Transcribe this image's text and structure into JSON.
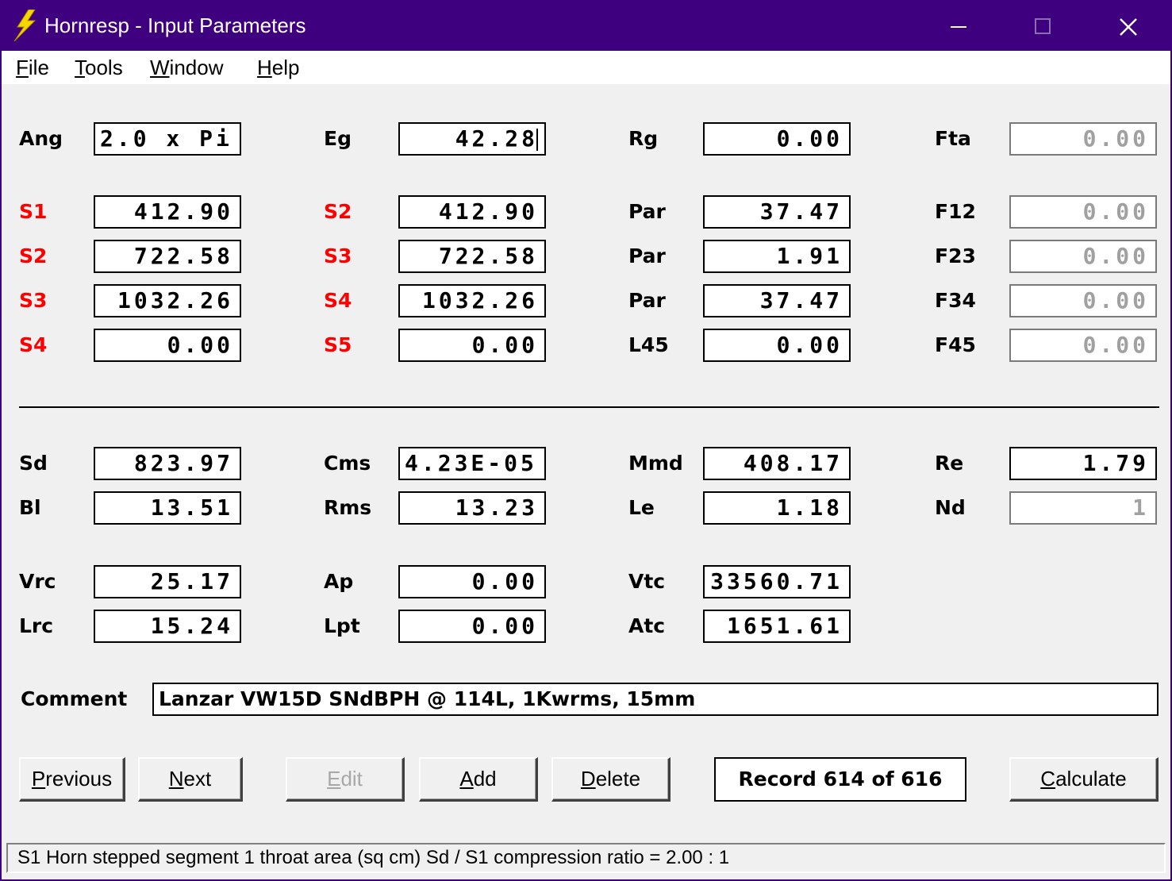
{
  "window": {
    "title": "Hornresp - Input Parameters",
    "controls": [
      "minimize-icon",
      "maximize-icon",
      "close-icon"
    ]
  },
  "menu": [
    {
      "pre": "",
      "u": "F",
      "post": "ile"
    },
    {
      "pre": "",
      "u": "T",
      "post": "ools"
    },
    {
      "pre": "",
      "u": "W",
      "post": "indow"
    },
    {
      "pre": "",
      "u": "H",
      "post": "elp"
    }
  ],
  "params": {
    "ang": {
      "label": "Ang",
      "value": "2.0 x Pi"
    },
    "eg": {
      "label": "Eg",
      "value": "42.28"
    },
    "rg": {
      "label": "Rg",
      "value": "0.00"
    },
    "fta": {
      "label": "Fta",
      "value": "0.00"
    },
    "col1": [
      {
        "label": "S1",
        "value": "412.90"
      },
      {
        "label": "S2",
        "value": "722.58"
      },
      {
        "label": "S3",
        "value": "1032.26"
      },
      {
        "label": "S4",
        "value": "0.00"
      }
    ],
    "col2": [
      {
        "label": "S2",
        "value": "412.90"
      },
      {
        "label": "S3",
        "value": "722.58"
      },
      {
        "label": "S4",
        "value": "1032.26"
      },
      {
        "label": "S5",
        "value": "0.00"
      }
    ],
    "col3": [
      {
        "label": "Par",
        "value": "37.47"
      },
      {
        "label": "Par",
        "value": "1.91"
      },
      {
        "label": "Par",
        "value": "37.47"
      },
      {
        "label": "L45",
        "value": "0.00"
      }
    ],
    "col4": [
      {
        "label": "F12",
        "value": "0.00"
      },
      {
        "label": "F23",
        "value": "0.00"
      },
      {
        "label": "F34",
        "value": "0.00"
      },
      {
        "label": "F45",
        "value": "0.00"
      }
    ],
    "driver": [
      {
        "label": "Sd",
        "value": "823.97"
      },
      {
        "label": "Cms",
        "value": "4.23E-05"
      },
      {
        "label": "Mmd",
        "value": "408.17"
      },
      {
        "label": "Re",
        "value": "1.79"
      },
      {
        "label": "Bl",
        "value": "13.51"
      },
      {
        "label": "Rms",
        "value": "13.23"
      },
      {
        "label": "Le",
        "value": "1.18"
      },
      {
        "label": "Nd",
        "value": "1"
      }
    ],
    "chamber": [
      {
        "label": "Vrc",
        "value": "25.17"
      },
      {
        "label": "Ap",
        "value": "0.00"
      },
      {
        "label": "Vtc",
        "value": "33560.71"
      },
      {
        "label": "Lrc",
        "value": "15.24"
      },
      {
        "label": "Lpt",
        "value": "0.00"
      },
      {
        "label": "Atc",
        "value": "1651.61"
      }
    ]
  },
  "comment": {
    "label": "Comment",
    "value": "Lanzar VW15D SNdBPH @ 114L, 1Kwrms, 15mm"
  },
  "buttons": {
    "previous": {
      "u": "P",
      "post": "revious"
    },
    "next": {
      "u": "N",
      "post": "ext"
    },
    "edit": {
      "u": "E",
      "post": "dit"
    },
    "add": {
      "u": "A",
      "post": "dd"
    },
    "delete": {
      "u": "D",
      "post": "elete"
    },
    "calculate": {
      "u": "C",
      "post": "alculate"
    }
  },
  "record": "Record 614 of 616",
  "status": "S1   Horn stepped segment 1 throat area  (sq cm)   Sd / S1 compression ratio = 2.00 : 1",
  "colors": {
    "titlebar": "#3f007f",
    "red_label": "#ff0000",
    "icon": "#f5d800"
  }
}
